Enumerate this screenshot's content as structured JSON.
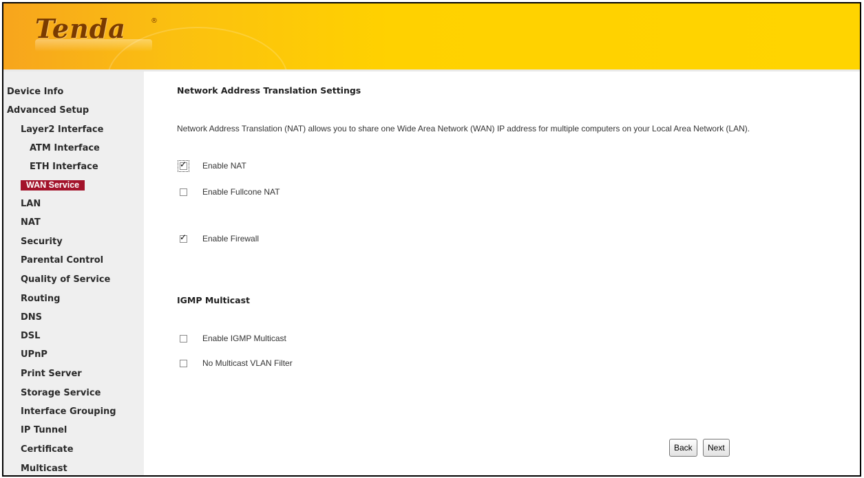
{
  "brand": {
    "logo_text": "Tenda",
    "reg_mark": "®"
  },
  "sidebar": {
    "items": [
      {
        "label": "Device Info"
      },
      {
        "label": "Advanced Setup"
      },
      {
        "label": "Layer2 Interface"
      },
      {
        "label": "ATM Interface"
      },
      {
        "label": "ETH Interface"
      },
      {
        "label": "WAN Service",
        "active": true
      },
      {
        "label": "LAN"
      },
      {
        "label": "NAT"
      },
      {
        "label": "Security"
      },
      {
        "label": "Parental Control"
      },
      {
        "label": "Quality of Service"
      },
      {
        "label": "Routing"
      },
      {
        "label": "DNS"
      },
      {
        "label": "DSL"
      },
      {
        "label": "UPnP"
      },
      {
        "label": "Print Server"
      },
      {
        "label": "Storage Service"
      },
      {
        "label": "Interface Grouping"
      },
      {
        "label": "IP Tunnel"
      },
      {
        "label": "Certificate"
      },
      {
        "label": "Multicast"
      }
    ]
  },
  "main": {
    "title": "Network Address Translation Settings",
    "description": "Network Address Translation (NAT) allows you to share one Wide Area Network (WAN) IP address for multiple computers on your Local Area Network (LAN).",
    "options": {
      "enable_nat": {
        "label": "Enable NAT",
        "checked": true
      },
      "enable_fullcone_nat": {
        "label": "Enable Fullcone NAT",
        "checked": false
      },
      "enable_firewall": {
        "label": "Enable Firewall",
        "checked": true
      }
    },
    "igmp_title": "IGMP Multicast",
    "igmp_options": {
      "enable_igmp_multicast": {
        "label": "Enable IGMP Multicast",
        "checked": false
      },
      "no_multicast_vlan_filter": {
        "label": "No Multicast VLAN Filter",
        "checked": false
      }
    },
    "buttons": {
      "back": "Back",
      "next": "Next"
    }
  },
  "colors": {
    "active_nav": "#a3132b",
    "header_yellow": "#ffd100",
    "sidebar_bg": "#efefef"
  }
}
